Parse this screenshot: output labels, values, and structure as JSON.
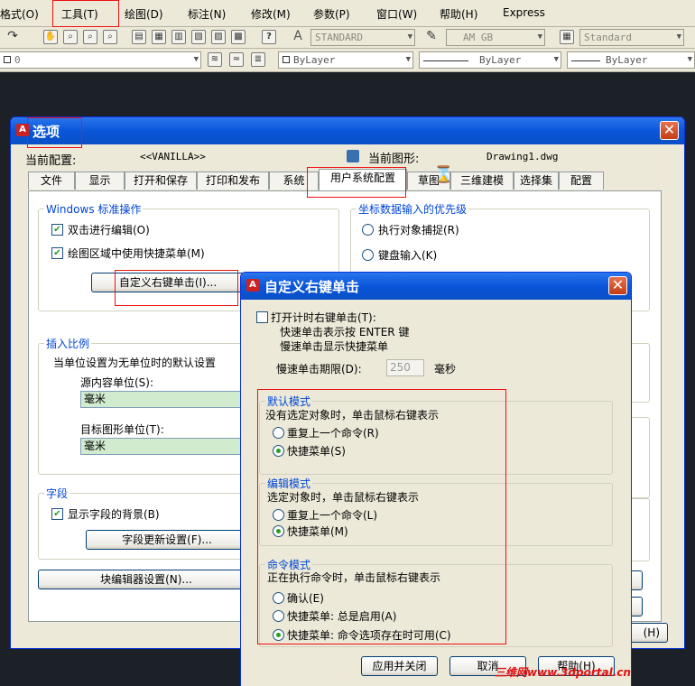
{
  "menu": [
    "格式(O)",
    "工具(T)",
    "绘图(D)",
    "标注(N)",
    "修改(M)",
    "参数(P)",
    "窗口(W)",
    "帮助(H)",
    "Express"
  ],
  "toolbar": {
    "text_style": "STANDARD",
    "dim_style": "AM GB",
    "table_style": "Standard",
    "layer": "0",
    "color": "ByLayer",
    "linetype": "ByLayer",
    "lineweight": "ByLayer"
  },
  "options": {
    "title": "选项",
    "profile_label": "当前配置:",
    "profile_value": "<<VANILLA>>",
    "drawing_label": "当前图形:",
    "drawing_value": "Drawing1.dwg",
    "tabs": [
      "文件",
      "显示",
      "打开和保存",
      "打印和发布",
      "系统",
      "用户系统配置",
      "草图",
      "三维建模",
      "选择集",
      "配置"
    ],
    "windows_ops": {
      "label": "Windows 标准操作",
      "dblclick": "双击进行编辑(O)",
      "shortcut_menu": "绘图区域中使用快捷菜单(M)",
      "right_click_btn": "自定义右键单击(I)..."
    },
    "coord_priority": {
      "label": "坐标数据输入的优先级",
      "osnap": "执行对象捕捉(R)",
      "keyboard": "键盘输入(K)"
    },
    "insert_scale": {
      "label": "插入比例",
      "desc": "当单位设置为无单位时的默认设置",
      "source_label": "源内容单位(S):",
      "source_value": "毫米",
      "target_label": "目标图形单位(T):",
      "target_value": "毫米"
    },
    "fields": {
      "label": "字段",
      "show_bg": "显示字段的背景(B)",
      "update_btn": "字段更新设置(F)..."
    },
    "block_editor_btn": "块编辑器设置(N)...",
    "help_btn_partial": "(H)"
  },
  "rightclick": {
    "title": "自定义右键单击",
    "timed": "打开计时右键单击(T):",
    "fast": "快速单击表示按 ENTER 键",
    "slow": "慢速单击显示快捷菜单",
    "duration_label": "慢速单击期限(D):",
    "duration_value": "250",
    "duration_unit": "毫秒",
    "default_mode": {
      "label": "默认模式",
      "desc": "没有选定对象时，单击鼠标右键表示",
      "repeat": "重复上一个命令(R)",
      "menu": "快捷菜单(S)"
    },
    "edit_mode": {
      "label": "编辑模式",
      "desc": "选定对象时，单击鼠标右键表示",
      "repeat": "重复上一个命令(L)",
      "menu": "快捷菜单(M)"
    },
    "command_mode": {
      "label": "命令模式",
      "desc": "正在执行命令时，单击鼠标右键表示",
      "enter": "确认(E)",
      "always": "快捷菜单: 总是启用(A)",
      "when_options": "快捷菜单: 命令选项存在时可用(C)"
    },
    "apply_btn": "应用并关闭",
    "cancel_btn": "取消",
    "help_btn": "帮助(H)"
  },
  "watermark": "三维网www.3dportal.cn",
  "colors": {
    "titlebar": "#0a56d9",
    "accent_green": "#21a121",
    "highlight_red": "#ee1111"
  }
}
